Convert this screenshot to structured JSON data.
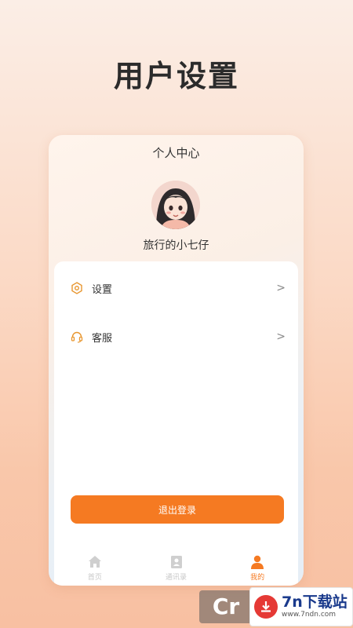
{
  "headline": "用户设置",
  "phone": {
    "title": "个人中心",
    "username": "旅行的小七仔",
    "menu": [
      {
        "icon": "settings-hex-icon",
        "label": "设置",
        "chevron": ">"
      },
      {
        "icon": "headset-icon",
        "label": "客服",
        "chevron": ">"
      }
    ],
    "logout_label": "退出登录",
    "tabs": [
      {
        "icon": "home-icon",
        "label": "首页",
        "active": false
      },
      {
        "icon": "contact-card-icon",
        "label": "通讯录",
        "active": false
      },
      {
        "icon": "user-icon",
        "label": "我的",
        "active": true
      }
    ]
  },
  "watermark": {
    "main": "7n下载站",
    "sub": "www.7ndn.com",
    "logo_text": "Cr"
  },
  "colors": {
    "accent": "#f57a22",
    "tab_inactive": "#c7c7c7"
  }
}
